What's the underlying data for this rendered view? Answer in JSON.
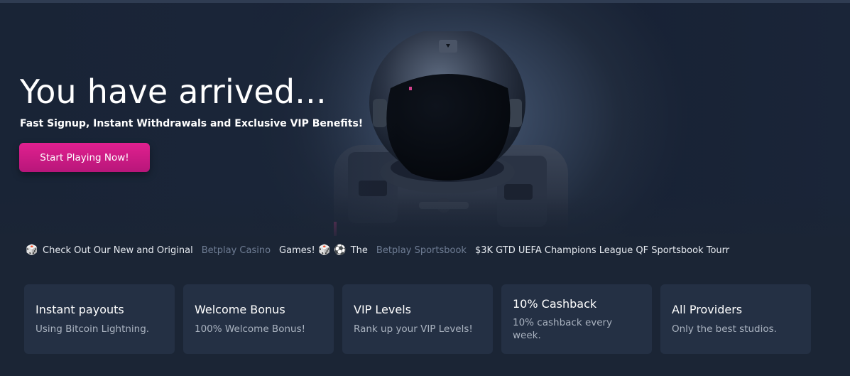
{
  "hero": {
    "title": "You have arrived...",
    "subtitle": "Fast Signup, Instant Withdrawals and Exclusive VIP Benefits!",
    "cta_label": "Start Playing Now!",
    "accent_color": "#d41c87"
  },
  "ticker": {
    "segments": [
      {
        "icon": "dice-icon",
        "text": "Check Out Our New and Original"
      },
      {
        "text": "Betplay Casino",
        "style": "link"
      },
      {
        "text": "Games!"
      },
      {
        "icon": "dice-icon"
      },
      {
        "icon": "soccer-ball-icon"
      },
      {
        "text": "The"
      },
      {
        "text": "Betplay Sportsbook",
        "style": "link"
      },
      {
        "text": "$3K GTD UEFA Champions League QF Sportsbook Tourr"
      }
    ]
  },
  "features": [
    {
      "title": "Instant payouts",
      "description": "Using Bitcoin Lightning."
    },
    {
      "title": "Welcome Bonus",
      "description": "100% Welcome Bonus!"
    },
    {
      "title": "VIP Levels",
      "description": "Rank up your VIP Levels!"
    },
    {
      "title": "10% Cashback",
      "description": "10% cashback every week."
    },
    {
      "title": "All Providers",
      "description": "Only the best studios."
    }
  ]
}
